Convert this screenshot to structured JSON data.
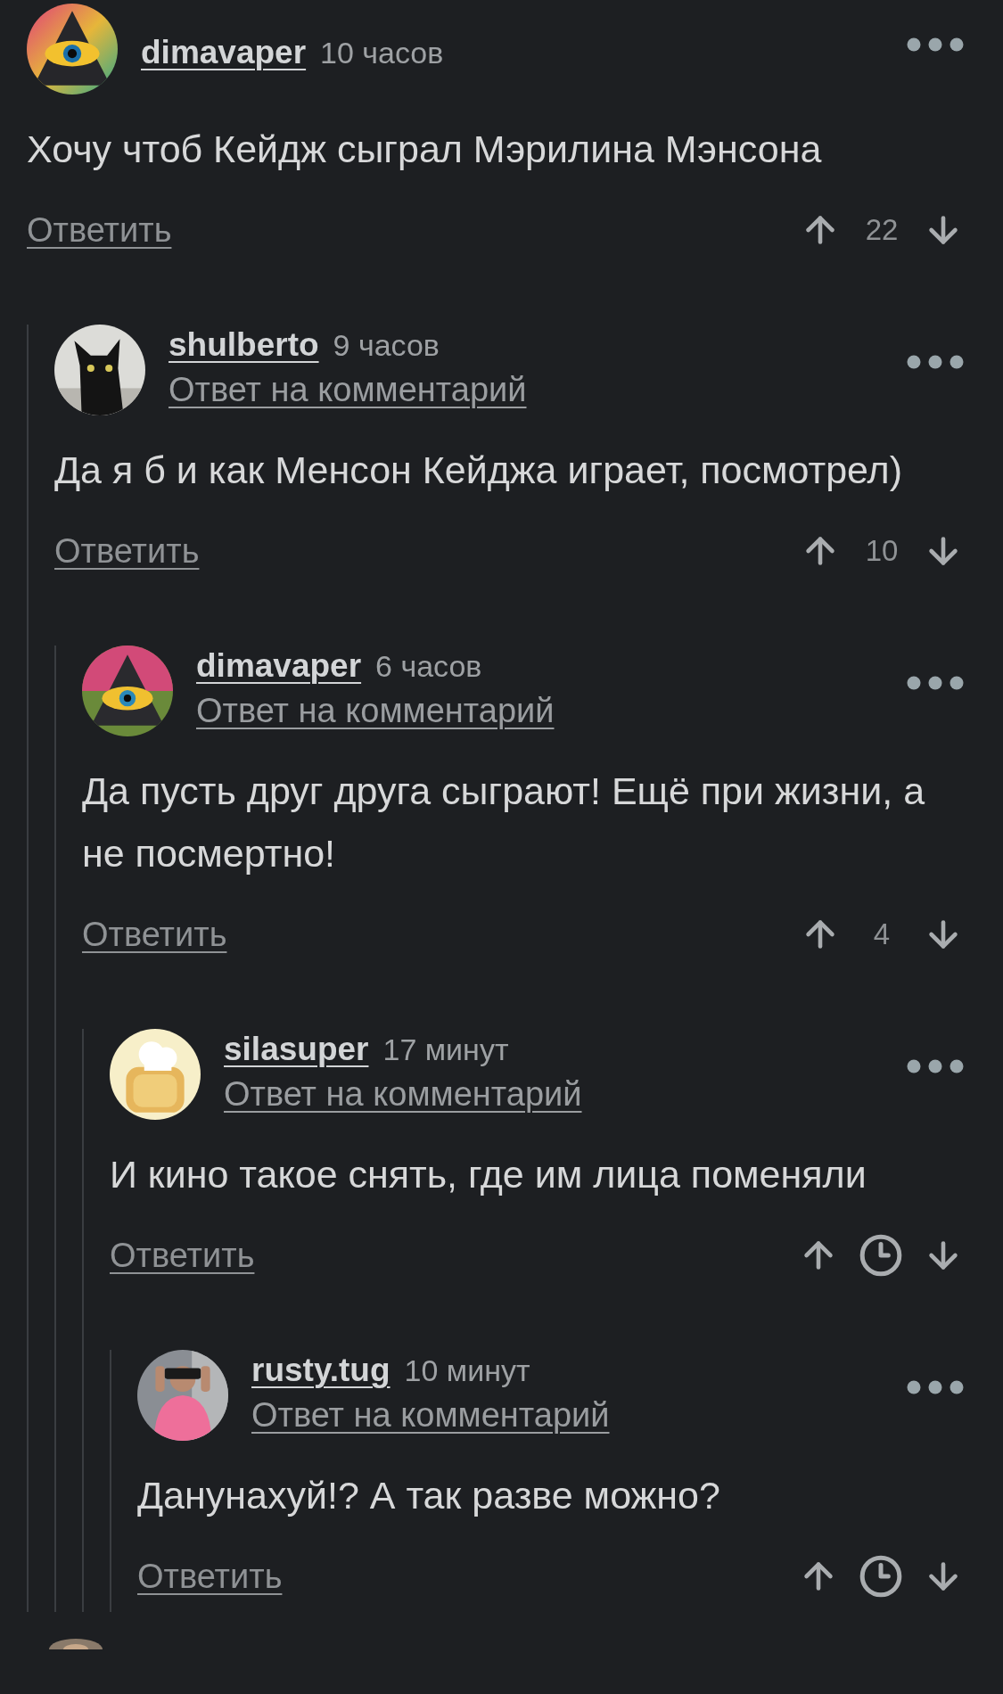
{
  "comments": [
    {
      "author": "dimavaper",
      "time": "10 часов",
      "text": "Хочу чтоб Кейдж сыграл Мэрилина Мэнсона",
      "reply_label": "Ответить",
      "rating": "22",
      "children": [
        {
          "author": "shulberto",
          "time": "9 часов",
          "reply_to": "Ответ на комментарий",
          "text": "Да я б и как Менсон Кейджа играет, посмотрел)",
          "reply_label": "Ответить",
          "rating": "10",
          "children": [
            {
              "author": "dimavaper",
              "time": "6 часов",
              "reply_to": "Ответ на комментарий",
              "text": "Да пусть друг друга сыграют! Ещё при жизни, а не посмертно!",
              "reply_label": "Ответить",
              "rating": "4",
              "children": [
                {
                  "author": "silasuper",
                  "time": "17 минут",
                  "reply_to": "Ответ на комментарий",
                  "text": "И кино такое снять, где им лица поменяли",
                  "reply_label": "Ответить",
                  "children": [
                    {
                      "author": "rusty.tug",
                      "time": "10 минут",
                      "reply_to": "Ответ на комментарий",
                      "text": "Данунахуй!? А так разве можно?",
                      "reply_label": "Ответить"
                    }
                  ]
                }
              ]
            }
          ]
        }
      ]
    }
  ]
}
